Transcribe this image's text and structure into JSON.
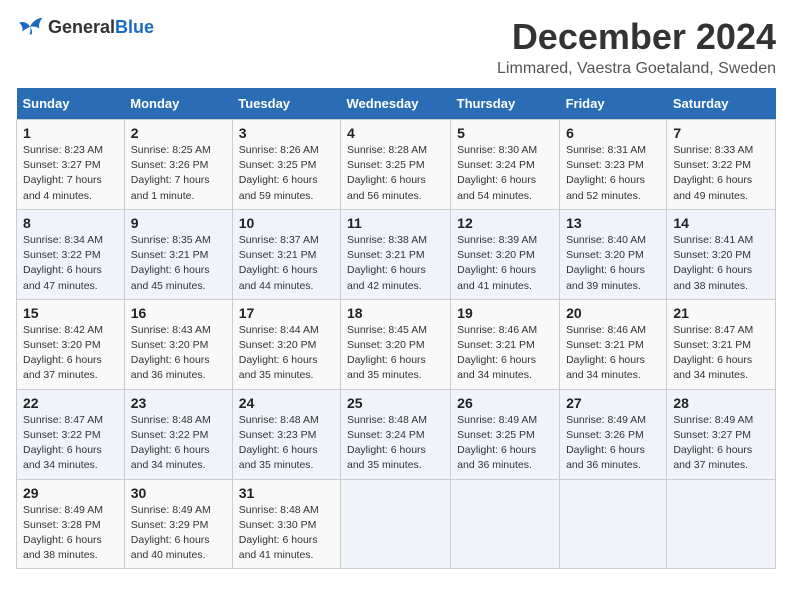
{
  "header": {
    "logo_general": "General",
    "logo_blue": "Blue",
    "month_title": "December 2024",
    "location": "Limmared, Vaestra Goetaland, Sweden"
  },
  "weekdays": [
    "Sunday",
    "Monday",
    "Tuesday",
    "Wednesday",
    "Thursday",
    "Friday",
    "Saturday"
  ],
  "weeks": [
    [
      {
        "day": "1",
        "sunrise": "8:23 AM",
        "sunset": "3:27 PM",
        "daylight": "7 hours and 4 minutes."
      },
      {
        "day": "2",
        "sunrise": "8:25 AM",
        "sunset": "3:26 PM",
        "daylight": "7 hours and 1 minute."
      },
      {
        "day": "3",
        "sunrise": "8:26 AM",
        "sunset": "3:25 PM",
        "daylight": "6 hours and 59 minutes."
      },
      {
        "day": "4",
        "sunrise": "8:28 AM",
        "sunset": "3:25 PM",
        "daylight": "6 hours and 56 minutes."
      },
      {
        "day": "5",
        "sunrise": "8:30 AM",
        "sunset": "3:24 PM",
        "daylight": "6 hours and 54 minutes."
      },
      {
        "day": "6",
        "sunrise": "8:31 AM",
        "sunset": "3:23 PM",
        "daylight": "6 hours and 52 minutes."
      },
      {
        "day": "7",
        "sunrise": "8:33 AM",
        "sunset": "3:22 PM",
        "daylight": "6 hours and 49 minutes."
      }
    ],
    [
      {
        "day": "8",
        "sunrise": "8:34 AM",
        "sunset": "3:22 PM",
        "daylight": "6 hours and 47 minutes."
      },
      {
        "day": "9",
        "sunrise": "8:35 AM",
        "sunset": "3:21 PM",
        "daylight": "6 hours and 45 minutes."
      },
      {
        "day": "10",
        "sunrise": "8:37 AM",
        "sunset": "3:21 PM",
        "daylight": "6 hours and 44 minutes."
      },
      {
        "day": "11",
        "sunrise": "8:38 AM",
        "sunset": "3:21 PM",
        "daylight": "6 hours and 42 minutes."
      },
      {
        "day": "12",
        "sunrise": "8:39 AM",
        "sunset": "3:20 PM",
        "daylight": "6 hours and 41 minutes."
      },
      {
        "day": "13",
        "sunrise": "8:40 AM",
        "sunset": "3:20 PM",
        "daylight": "6 hours and 39 minutes."
      },
      {
        "day": "14",
        "sunrise": "8:41 AM",
        "sunset": "3:20 PM",
        "daylight": "6 hours and 38 minutes."
      }
    ],
    [
      {
        "day": "15",
        "sunrise": "8:42 AM",
        "sunset": "3:20 PM",
        "daylight": "6 hours and 37 minutes."
      },
      {
        "day": "16",
        "sunrise": "8:43 AM",
        "sunset": "3:20 PM",
        "daylight": "6 hours and 36 minutes."
      },
      {
        "day": "17",
        "sunrise": "8:44 AM",
        "sunset": "3:20 PM",
        "daylight": "6 hours and 35 minutes."
      },
      {
        "day": "18",
        "sunrise": "8:45 AM",
        "sunset": "3:20 PM",
        "daylight": "6 hours and 35 minutes."
      },
      {
        "day": "19",
        "sunrise": "8:46 AM",
        "sunset": "3:21 PM",
        "daylight": "6 hours and 34 minutes."
      },
      {
        "day": "20",
        "sunrise": "8:46 AM",
        "sunset": "3:21 PM",
        "daylight": "6 hours and 34 minutes."
      },
      {
        "day": "21",
        "sunrise": "8:47 AM",
        "sunset": "3:21 PM",
        "daylight": "6 hours and 34 minutes."
      }
    ],
    [
      {
        "day": "22",
        "sunrise": "8:47 AM",
        "sunset": "3:22 PM",
        "daylight": "6 hours and 34 minutes."
      },
      {
        "day": "23",
        "sunrise": "8:48 AM",
        "sunset": "3:22 PM",
        "daylight": "6 hours and 34 minutes."
      },
      {
        "day": "24",
        "sunrise": "8:48 AM",
        "sunset": "3:23 PM",
        "daylight": "6 hours and 35 minutes."
      },
      {
        "day": "25",
        "sunrise": "8:48 AM",
        "sunset": "3:24 PM",
        "daylight": "6 hours and 35 minutes."
      },
      {
        "day": "26",
        "sunrise": "8:49 AM",
        "sunset": "3:25 PM",
        "daylight": "6 hours and 36 minutes."
      },
      {
        "day": "27",
        "sunrise": "8:49 AM",
        "sunset": "3:26 PM",
        "daylight": "6 hours and 36 minutes."
      },
      {
        "day": "28",
        "sunrise": "8:49 AM",
        "sunset": "3:27 PM",
        "daylight": "6 hours and 37 minutes."
      }
    ],
    [
      {
        "day": "29",
        "sunrise": "8:49 AM",
        "sunset": "3:28 PM",
        "daylight": "6 hours and 38 minutes."
      },
      {
        "day": "30",
        "sunrise": "8:49 AM",
        "sunset": "3:29 PM",
        "daylight": "6 hours and 40 minutes."
      },
      {
        "day": "31",
        "sunrise": "8:48 AM",
        "sunset": "3:30 PM",
        "daylight": "6 hours and 41 minutes."
      },
      null,
      null,
      null,
      null
    ]
  ],
  "labels": {
    "sunrise": "Sunrise:",
    "sunset": "Sunset:",
    "daylight": "Daylight:"
  }
}
